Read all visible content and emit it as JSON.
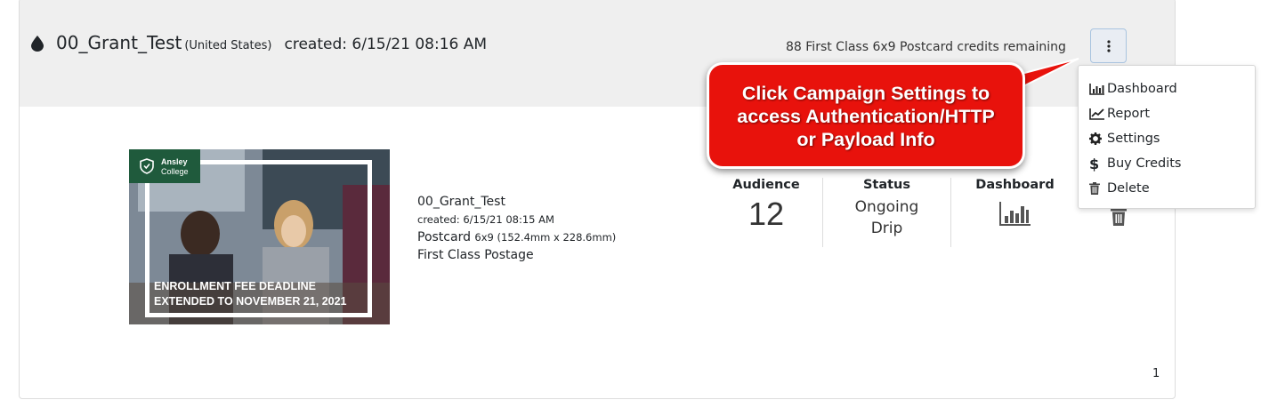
{
  "campaign": {
    "title": "00_Grant_Test",
    "country": "(United States)",
    "created": "created: 6/15/21 08:16 AM",
    "credits_remaining": "88 First Class 6x9 Postcard credits remaining",
    "menu_button_icon": "vertical-ellipsis-icon",
    "title_icon": "ink-drop-icon"
  },
  "mailpiece": {
    "logo_name": "Ansley",
    "logo_sub": "College",
    "headline_line1": "ENROLLMENT FEE DEADLINE",
    "headline_line2": "EXTENDED TO NOVEMBER 21, 2021",
    "name": "00_Grant_Test",
    "created": "created: 6/15/21 08:15 AM",
    "type": "Postcard",
    "size": "6x9 (152.4mm x 228.6mm)",
    "postage": "First Class Postage"
  },
  "stats": {
    "audience_label": "Audience",
    "audience_value": "12",
    "status_label": "Status",
    "status_line1": "Ongoing",
    "status_line2": "Drip",
    "dashboard_label": "Dashboard"
  },
  "menu": {
    "items": [
      {
        "label": "Dashboard",
        "icon": "bar-chart-icon"
      },
      {
        "label": "Report",
        "icon": "line-chart-icon"
      },
      {
        "label": "Settings",
        "icon": "gear-icon"
      },
      {
        "label": "Buy Credits",
        "icon": "dollar-icon"
      },
      {
        "label": "Delete",
        "icon": "trash-icon"
      }
    ]
  },
  "callout": {
    "line1": "Click Campaign Settings to",
    "line2": "access Authentication/HTTP",
    "line3": "or Payload Info"
  },
  "pagination": {
    "page": "1"
  },
  "colors": {
    "header_bg": "#efefef",
    "callout_red": "#e8120c",
    "logo_green": "#1f5a3c",
    "icon_gray": "#555555"
  }
}
